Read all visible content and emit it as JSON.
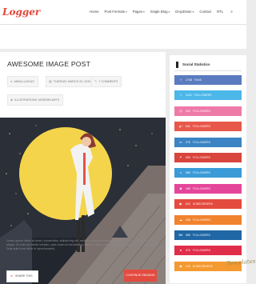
{
  "header": {
    "logo": "Logger",
    "nav": [
      {
        "label": "Home",
        "has_dropdown": false
      },
      {
        "label": "Post Formats",
        "has_dropdown": true
      },
      {
        "label": "Pages",
        "has_dropdown": true
      },
      {
        "label": "Single Blog",
        "has_dropdown": true
      },
      {
        "label": "DropDown",
        "has_dropdown": true
      },
      {
        "label": "Contact",
        "has_dropdown": false
      },
      {
        "label": "RTL",
        "has_dropdown": false
      }
    ],
    "search_icon": "search-icon"
  },
  "post": {
    "title": "AWESOME IMAGE POST",
    "meta": {
      "author": "ANNA LUCKAS",
      "date": "TUESDAY, MARCH 24, 2015",
      "comments": "7 COMMENTS",
      "tags": "ILLUSTRATIONS, MODERN ARTS"
    },
    "excerpt": "Lorem ipsum dolor sit amet, consectetur adipisicing elit, sed do eiusmod tempor incididunt ut labore et dolore magna aliqua. Ut enim ad minim veniam, quis nostrud exercitation ullamco laboris nisi ut aliquip ex ea commodo consequat. Duis aute irure dolor in reprehenderit...",
    "share_label": "SHARE THIS",
    "continue_label": "CONTINUE READING"
  },
  "sidebar": {
    "widget_title": "Social Statistics",
    "items": [
      {
        "icon": "facebook-icon",
        "glyph": "f",
        "count": "1748",
        "label": "FANS",
        "color": "#5a7bbf"
      },
      {
        "icon": "twitter-icon",
        "glyph": "t",
        "count": "1120",
        "label": "FOLLOWERS",
        "color": "#4cb8ea"
      },
      {
        "icon": "dribbble-icon",
        "glyph": "◎",
        "count": "312",
        "label": "FOLLOWERS",
        "color": "#ee7aa8"
      },
      {
        "icon": "google-plus-icon",
        "glyph": "g+",
        "count": "541",
        "label": "FOLLOWERS",
        "color": "#e8584a"
      },
      {
        "icon": "linkedin-icon",
        "glyph": "in",
        "count": "275",
        "label": "FOLLOWERS",
        "color": "#3c84c4"
      },
      {
        "icon": "pinterest-icon",
        "glyph": "P",
        "count": "403",
        "label": "FOLLOWERS",
        "color": "#d9443c"
      },
      {
        "icon": "vimeo-icon",
        "glyph": "v",
        "count": "289",
        "label": "FOLLOWERS",
        "color": "#3a9bd8"
      },
      {
        "icon": "instagram-icon",
        "glyph": "◙",
        "count": "155",
        "label": "FOLLOWERS",
        "color": "#e4469a"
      },
      {
        "icon": "youtube-icon",
        "glyph": "▶",
        "count": "612",
        "label": "SUBSCRIBERS",
        "color": "#e44b3f"
      },
      {
        "icon": "soundcloud-icon",
        "glyph": "☁",
        "count": "208",
        "label": "FOLLOWERS",
        "color": "#f1832f"
      },
      {
        "icon": "behance-icon",
        "glyph": "Bē",
        "count": "355",
        "label": "FOLLOWERS",
        "color": "#1f67a5"
      },
      {
        "icon": "flickr-icon",
        "glyph": "●",
        "count": "470",
        "label": "FOLLOWERS",
        "color": "#e02e4a"
      },
      {
        "icon": "rss-icon",
        "glyph": "◉",
        "count": "129",
        "label": "SUBSCRIBERS",
        "color": "#f49a30"
      }
    ]
  },
  "watermark": "Templates"
}
